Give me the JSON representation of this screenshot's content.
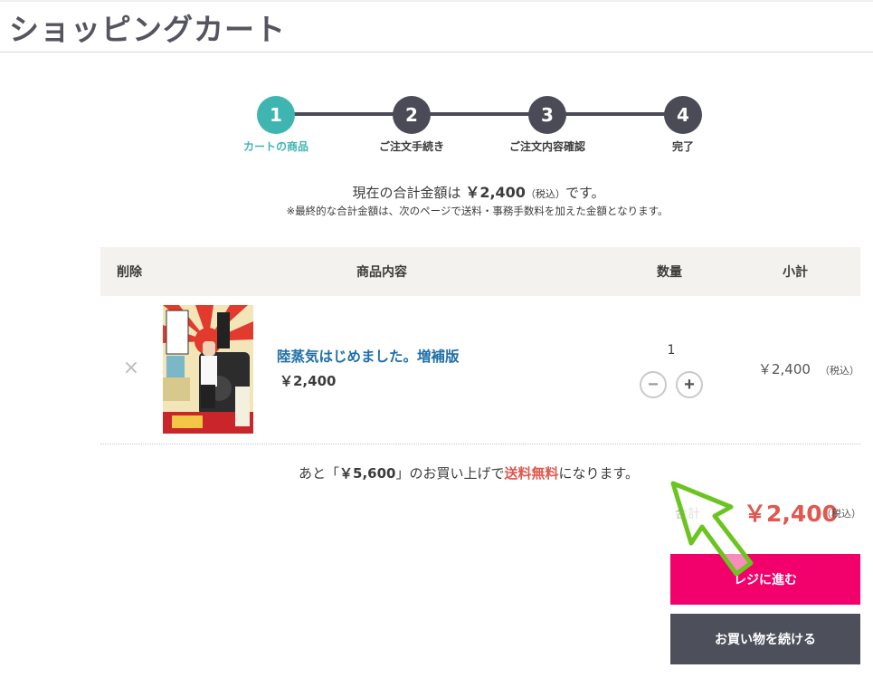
{
  "page": {
    "title": "ショッピングカート"
  },
  "stepper": {
    "steps": [
      {
        "number": "1",
        "label": "カートの商品"
      },
      {
        "number": "2",
        "label": "ご注文手続き"
      },
      {
        "number": "3",
        "label": "ご注文内容確認"
      },
      {
        "number": "4",
        "label": "完了"
      }
    ],
    "active_step": 1
  },
  "summary": {
    "prefix": "現在の合計金額は ",
    "amount": "￥2,400",
    "tax": "（税込）",
    "suffix": "です。",
    "note": "※最終的な合計金額は、次のページで送料・事務手数料を加えた金額となります。"
  },
  "table": {
    "headers": {
      "delete": "削除",
      "product": "商品内容",
      "quantity": "数量",
      "subtotal": "小計"
    },
    "rows": [
      {
        "remove_icon": "×",
        "name": "陸蒸気はじめました。増補版",
        "price": "￥2,400",
        "quantity": "1",
        "minus": "−",
        "plus": "+",
        "subtotal": "￥2,400",
        "subtotal_tax": "（税込）"
      }
    ]
  },
  "shipping": {
    "prefix": "あと「",
    "amount": "￥5,600",
    "middle": "」のお買い上げで",
    "free": "送料無料",
    "suffix": "になります。"
  },
  "total": {
    "label": "合計",
    "amount": "￥2,400",
    "tax": "（税込）"
  },
  "buttons": {
    "checkout": "レジに進む",
    "continue": "お買い物を続ける"
  },
  "colors": {
    "accent": "#3fb5b1",
    "checkout": "#f2006b",
    "price_red": "#e0584f",
    "arrow": "#6cc421"
  },
  "icons": {
    "remove": "close-icon",
    "minus": "minus-icon",
    "plus": "plus-icon",
    "pointer": "arrow-pointer-icon"
  }
}
